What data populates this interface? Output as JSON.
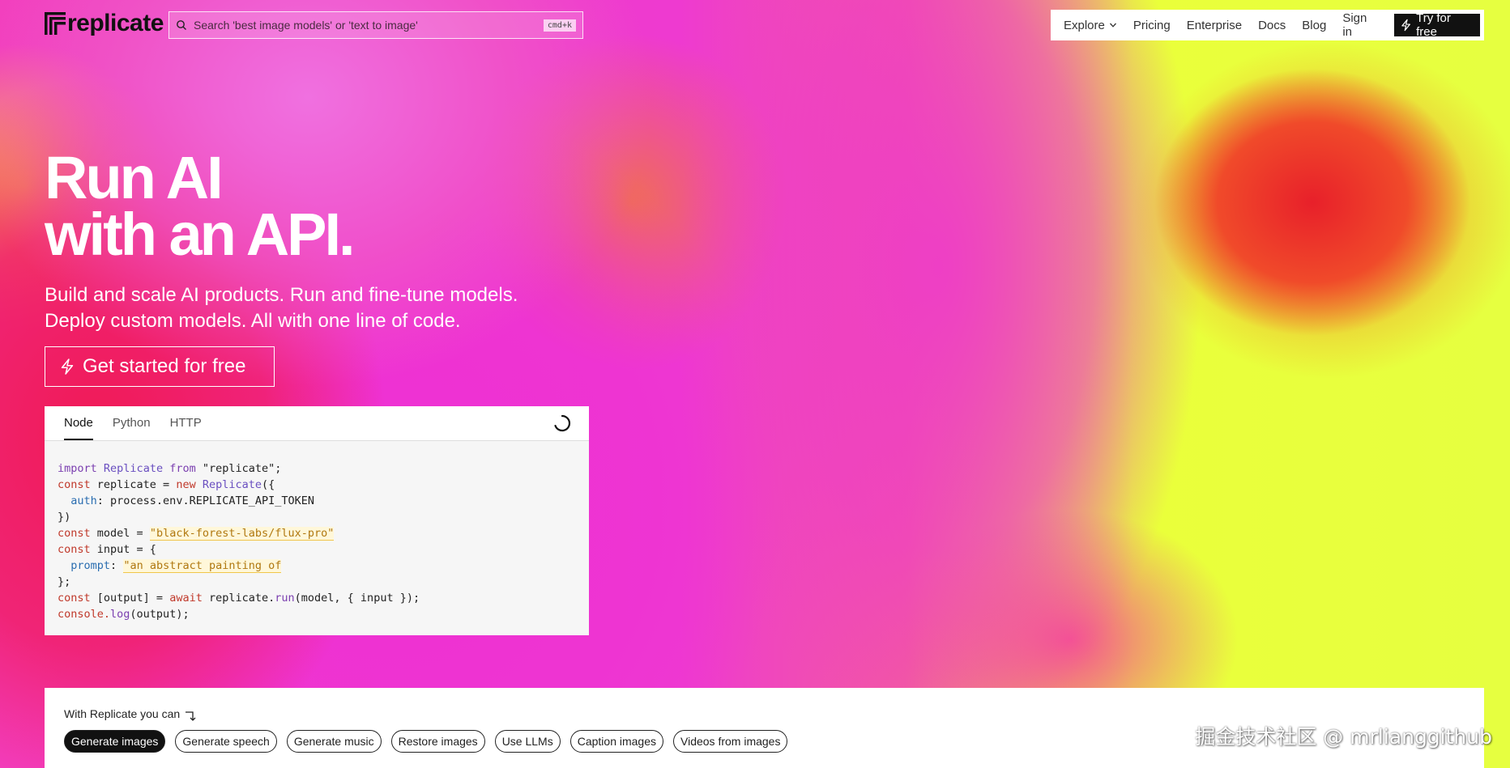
{
  "header": {
    "brand": "replicate",
    "search": {
      "placeholder": "Search 'best image models' or 'text to image'",
      "shortcut": "cmd+k"
    },
    "nav": {
      "items": [
        "Explore",
        "Pricing",
        "Enterprise",
        "Docs",
        "Blog",
        "Sign in"
      ],
      "cta": "Try for free"
    }
  },
  "hero": {
    "title_line1": "Run AI",
    "title_line2": "with an API.",
    "subtitle_line1": "Build and scale AI products. Run and fine-tune models.",
    "subtitle_line2": "Deploy custom models. All with one line of code.",
    "cta": "Get started for free"
  },
  "code_card": {
    "tabs": [
      "Node",
      "Python",
      "HTTP"
    ],
    "active_tab": "Node",
    "code": {
      "l1_import": "import",
      "l1_cls": "Replicate",
      "l1_from": "from",
      "l1_str": "\"replicate\";",
      "l2_const": "const",
      "l2_var": "replicate =",
      "l2_new": "new",
      "l2_cls": "Replicate",
      "l2_end": "({",
      "l3_prop": "auth",
      "l3_val": ": process.env.REPLICATE_API_TOKEN",
      "l4": "})",
      "l5_const": "const",
      "l5_var": "model =",
      "l5_str": "\"black-forest-labs/flux-pro\"",
      "l6_const": "const",
      "l6_var": "input = {",
      "l7_prop": "prompt",
      "l7_colon": ":",
      "l7_str": "\"an abstract painting of",
      "l8": "};",
      "l9_const": "const",
      "l9_var": "[output] =",
      "l9_await": "await",
      "l9_obj": "replicate.",
      "l9_fn": "run",
      "l9_args": "(model, { input });",
      "l10_obj": "console.",
      "l10_fn": "log",
      "l10_args": "(output);"
    }
  },
  "capabilities": {
    "label": "With Replicate you can",
    "chips": [
      "Generate images",
      "Generate speech",
      "Generate music",
      "Restore images",
      "Use LLMs",
      "Caption images",
      "Videos from images"
    ],
    "active_chip": "Generate images"
  },
  "watermark": "掘金技术社区 @ mrlianggithub"
}
